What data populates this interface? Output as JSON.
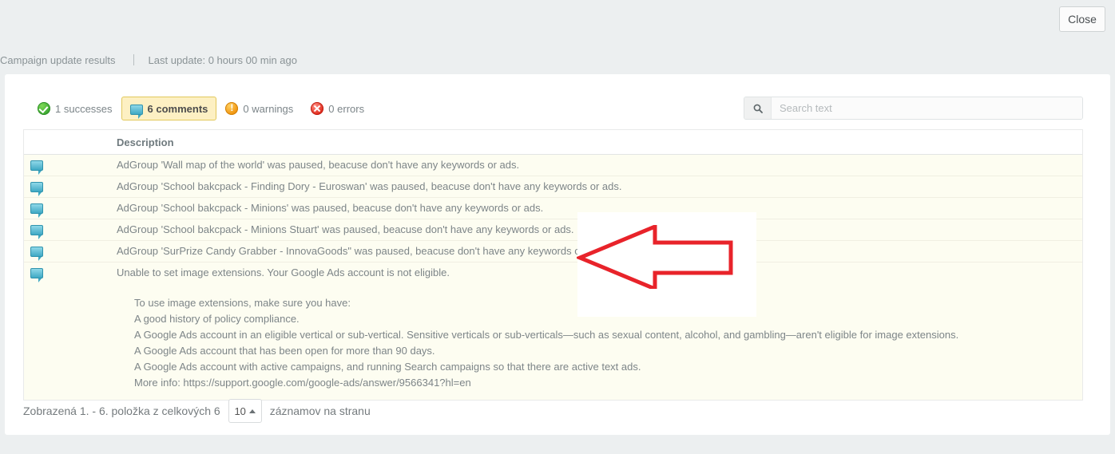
{
  "header": {
    "close_label": "Close",
    "breadcrumb_title": "Campaign update results",
    "last_update": "Last update: 0 hours 00 min ago"
  },
  "filters": [
    {
      "icon": "success-icon",
      "label": "1 successes",
      "active": false
    },
    {
      "icon": "comment-icon",
      "label": "6 comments",
      "active": true
    },
    {
      "icon": "warning-icon",
      "label": "0 warnings",
      "active": false
    },
    {
      "icon": "error-icon",
      "label": "0 errors",
      "active": false
    }
  ],
  "search": {
    "icon": "search-icon",
    "placeholder": "Search text",
    "value": ""
  },
  "table": {
    "columns": [
      "",
      "Description"
    ],
    "rows": [
      {
        "icon": "comment-icon",
        "description": "AdGroup 'Wall map of the world' was paused, beacuse don't have any keywords or ads."
      },
      {
        "icon": "comment-icon",
        "description": "AdGroup 'School bakcpack - Finding Dory - Euroswan' was paused, beacuse don't have any keywords or ads."
      },
      {
        "icon": "comment-icon",
        "description": "AdGroup 'School bakcpack - Minions' was paused, beacuse don't have any keywords or ads."
      },
      {
        "icon": "comment-icon",
        "description": "AdGroup 'School bakcpack - Minions Stuart' was paused, beacuse don't have any keywords or ads."
      },
      {
        "icon": "comment-icon",
        "description": "AdGroup 'SurPrize Candy Grabber - InnovaGoods\" was paused, beacuse don't have any keywords or ads."
      },
      {
        "icon": "comment-icon",
        "description": "Unable to set image extensions. Your Google Ads account is not eligible."
      }
    ],
    "detail_lines": [
      "To use image extensions, make sure you have:",
      "A good history of policy compliance.",
      "A Google Ads account in an eligible vertical or sub-vertical. Sensitive verticals or sub-verticals—such as sexual content, alcohol, and gambling—aren't eligible for image extensions.",
      "A Google Ads account that has been open for more than 90 days.",
      "A Google Ads account with active campaigns, and running Search campaigns so that there are active text ads.",
      "More info: https://support.google.com/google-ads/answer/9566341?hl=en"
    ]
  },
  "pagination": {
    "summary": "Zobrazená 1. - 6. položka z celkových 6",
    "page_size": "10",
    "suffix": "záznamov na stranu"
  },
  "annotation": {
    "shape": "left-arrow",
    "color": "#e8232a"
  },
  "colors": {
    "page_bg": "#eceff0",
    "card_bg": "#ffffff",
    "row_bg": "#fdfdf1",
    "active_chip_bg": "#fdf0c3",
    "active_chip_border": "#e2c85c",
    "text": "#7d8588",
    "accent_red": "#e8232a"
  }
}
